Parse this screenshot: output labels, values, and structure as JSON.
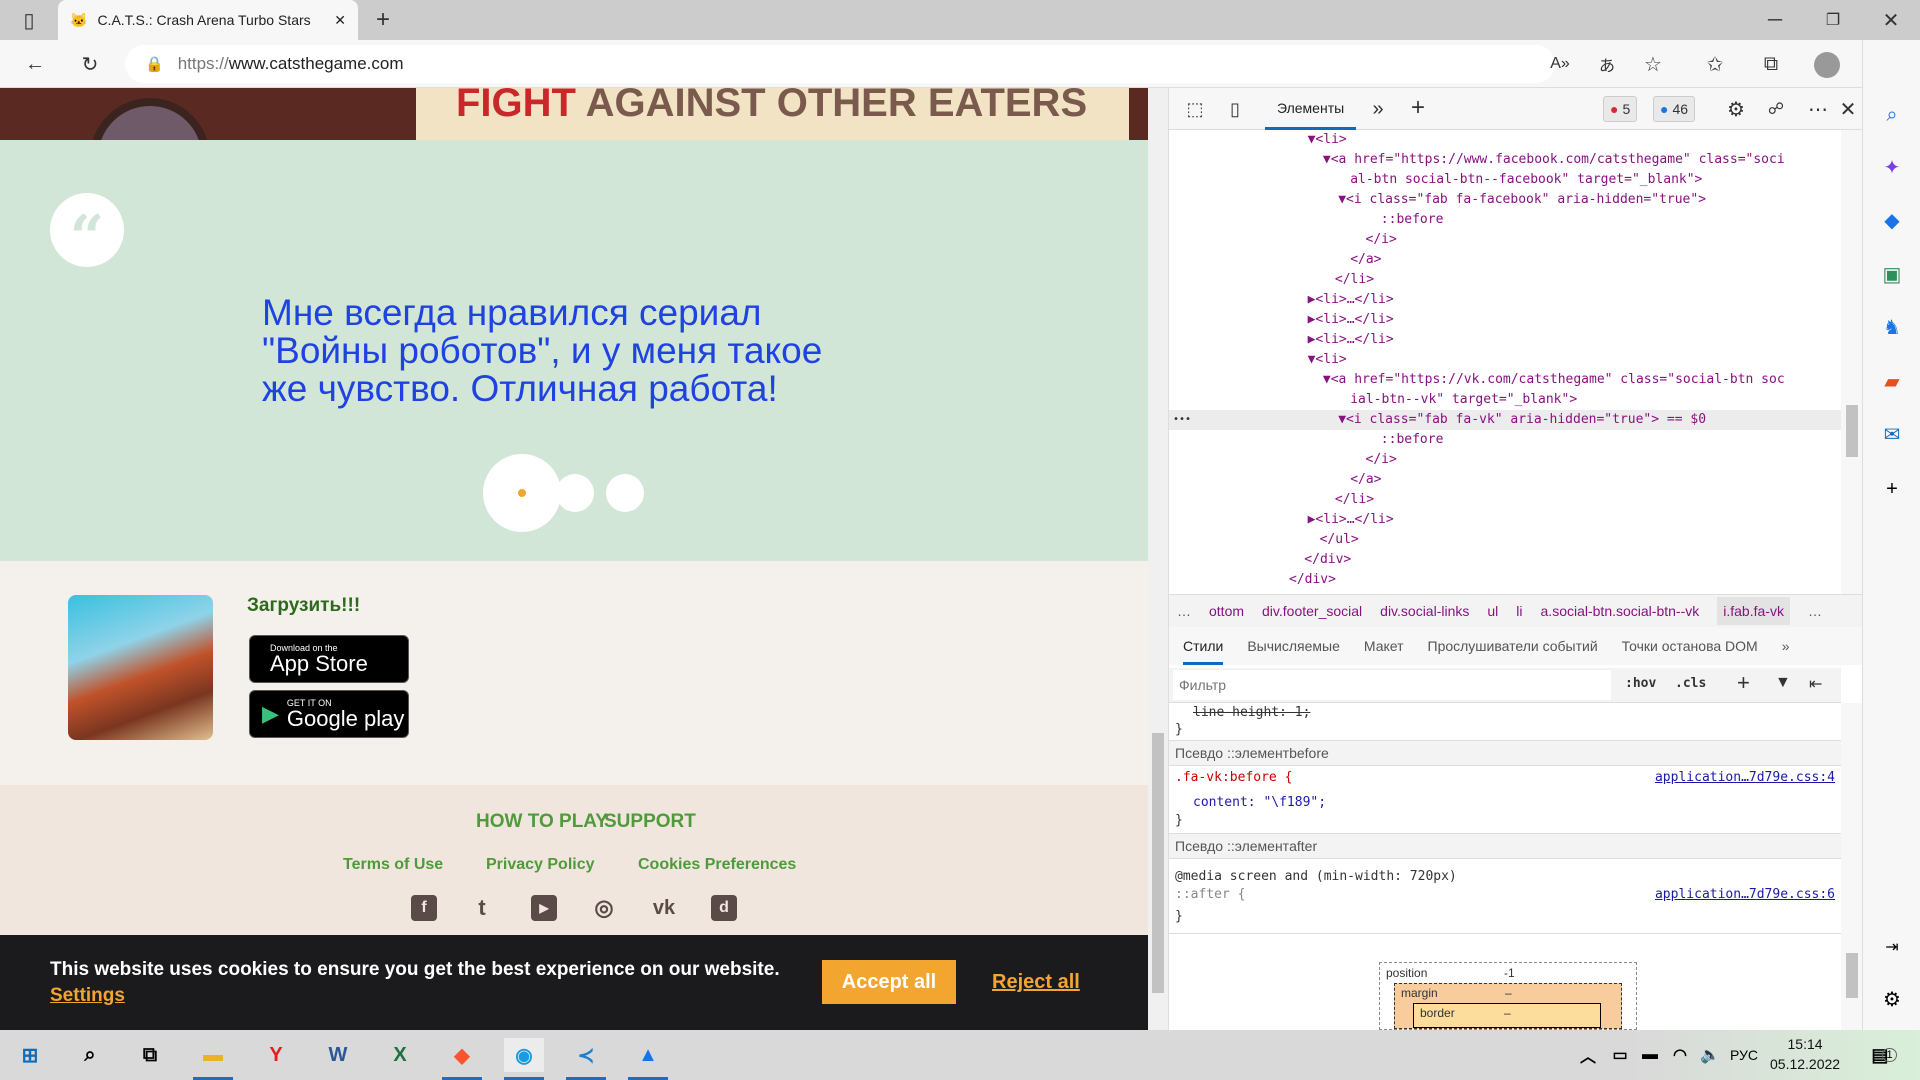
{
  "browser": {
    "tab_title": "C.A.T.S.: Crash Arena Turbo Stars",
    "url_scheme": "https://",
    "url_host": "www.catsthegame.com",
    "window_controls": [
      "minimize",
      "maximize",
      "close"
    ]
  },
  "page": {
    "banner_text_red": "FIGHT",
    "banner_text": " AGAINST OTHER EATERS",
    "quote_mark": "“",
    "testimonial": "Мне всегда нравился сериал \"Войны роботов\", и у меня такое же чувство. Отличная работа!",
    "carousel": {
      "count": 3,
      "active": 1
    },
    "download_title": "Загрузить!!!",
    "appstore_small": "Download on the",
    "appstore_big": "App Store",
    "googleplay_small": "GET IT ON",
    "googleplay_big": "Google play",
    "footer_main_links": [
      "HOW TO PLAY",
      "SUPPORT"
    ],
    "footer_links": [
      "Terms of Use",
      "Privacy Policy",
      "Cookies Preferences"
    ],
    "social": [
      {
        "name": "facebook",
        "glyph": "f"
      },
      {
        "name": "twitter",
        "glyph": "t"
      },
      {
        "name": "youtube",
        "glyph": "▶"
      },
      {
        "name": "instagram",
        "glyph": "◎"
      },
      {
        "name": "vk",
        "glyph": "vk"
      },
      {
        "name": "discord",
        "glyph": "d"
      }
    ],
    "cookie_text": "This website uses cookies to ensure you get the best experience on our website.",
    "cookie_settings": "Settings",
    "accept_all": "Accept all",
    "reject_all": "Reject all"
  },
  "devtools": {
    "tab_elements": "Элементы",
    "errors": "5",
    "messages": "46",
    "dom_lines": [
      {
        "d": 3,
        "h": "▼<li>"
      },
      {
        "d": 4,
        "h": "▼<a href=\"https://www.facebook.com/catsthegame\" class=\"soci"
      },
      {
        "d": 5,
        "h": "al-btn social-btn--facebook\" target=\"_blank\">"
      },
      {
        "d": 5,
        "h": "▼<i class=\"fab fa-facebook\" aria-hidden=\"true\">"
      },
      {
        "d": 7,
        "h": "::before"
      },
      {
        "d": 6,
        "h": "</i>"
      },
      {
        "d": 5,
        "h": "</a>"
      },
      {
        "d": 4,
        "h": "</li>"
      },
      {
        "d": 3,
        "h": "▶<li>…</li>"
      },
      {
        "d": 3,
        "h": "▶<li>…</li>"
      },
      {
        "d": 3,
        "h": "▶<li>…</li>"
      },
      {
        "d": 3,
        "h": "▼<li>"
      },
      {
        "d": 4,
        "h": "▼<a href=\"https://vk.com/catsthegame\" class=\"social-btn soc"
      },
      {
        "d": 5,
        "h": "ial-btn--vk\" target=\"_blank\">"
      },
      {
        "d": 5,
        "h": "▼<i class=\"fab fa-vk\" aria-hidden=\"true\"> == $0",
        "sel": true
      },
      {
        "d": 7,
        "h": "::before"
      },
      {
        "d": 6,
        "h": "</i>"
      },
      {
        "d": 5,
        "h": "</a>"
      },
      {
        "d": 4,
        "h": "</li>"
      },
      {
        "d": 3,
        "h": "▶<li>…</li>"
      },
      {
        "d": 3,
        "h": "</ul>"
      },
      {
        "d": 2,
        "h": "</div>"
      },
      {
        "d": 1,
        "h": "</div>"
      }
    ],
    "breadcrumbs": [
      "…",
      "ottom",
      "div.footer_social",
      "div.social-links",
      "ul",
      "li",
      "a.social-btn.social-btn--vk",
      "i.fab.fa-vk",
      "…"
    ],
    "subtabs": [
      "Стили",
      "Вычисляемые",
      "Макет",
      "Прослушиватели событий",
      "Точки останова DOM"
    ],
    "filter_placeholder": "Фильтр",
    "hov": ":hov",
    "cls": ".cls",
    "styles": {
      "struck_line": "line-height: 1;",
      "brace": "}",
      "pseudo_before_header": "Псевдо ::элементbefore",
      "before_selector": ".fa-vk:before {",
      "before_source": "application…7d79e.css:4",
      "before_prop": "content: \"\\f189\";",
      "pseudo_after_header": "Псевдо ::элементafter",
      "media": "@media screen and (min-width: 720px)",
      "after_selector": "::after {",
      "after_source": "application…7d79e.css:6"
    },
    "box_model": {
      "position_label": "position",
      "position_value": "-1",
      "margin_label": "margin",
      "margin_value": "–",
      "border_label": "border",
      "border_value": "–"
    }
  },
  "taskbar": {
    "language": "РУС",
    "time": "15:14",
    "date": "05.12.2022",
    "notifications": "1"
  }
}
